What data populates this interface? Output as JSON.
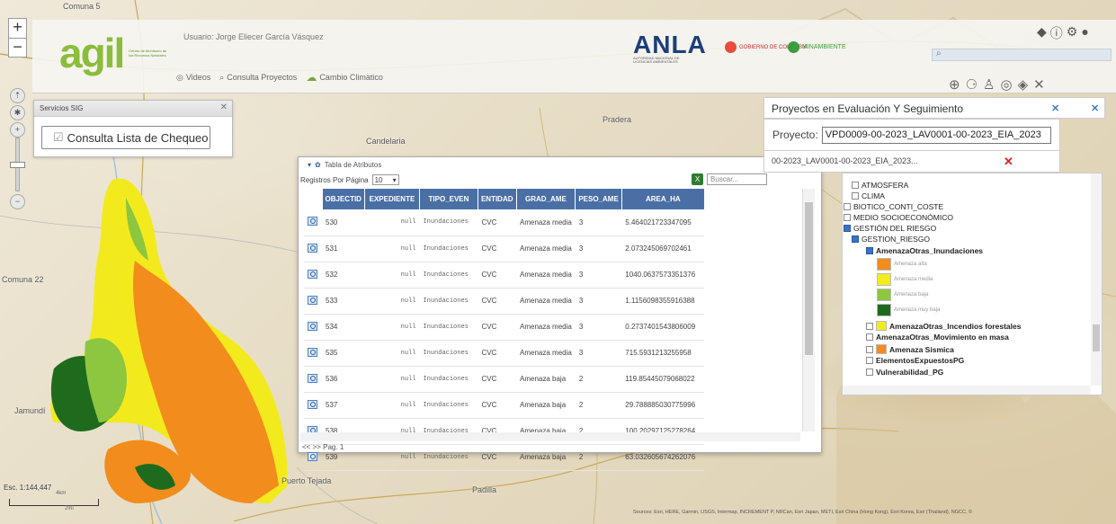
{
  "header": {
    "logo": "agil",
    "logo_sub": "Centro de Monitoreo de los Recursos Naturales",
    "user": "Usuario: Jorge Eliecer García Vásquez",
    "nav": [
      "Videos",
      "Consulta Proyectos",
      "Cambio Climatico"
    ],
    "brand": "ANLA",
    "brand_sub": "AUTORIDAD NACIONAL DE LICENCIAS AMBIENTALES",
    "gob": "GOBIERNO DE COLOMBIA",
    "min": "MINAMBIENTE",
    "search_placeholder": ""
  },
  "map_labels": {
    "comuna5": "Comuna 5",
    "candelaria": "Candelaria",
    "pradera": "Pradera",
    "comuna22": "Comuna 22",
    "jamundi": "Jamundí",
    "puerto_tejada": "Puerto Tejada",
    "padilla": "Padilla"
  },
  "sig_panel": {
    "title": "Servicios SIG",
    "button": "Consulta Lista de Chequeo"
  },
  "attr_table": {
    "title": "Tabla de Atributos",
    "per_page_label": "Registros Por Página",
    "per_page_value": "10",
    "search_placeholder": "Buscar...",
    "columns": [
      "OBJECTID",
      "EXPEDIENTE",
      "TIPO_EVEN",
      "ENTIDAD",
      "GRAD_AME",
      "PESO_AME",
      "AREA_ha"
    ],
    "rows": [
      {
        "id": "530",
        "exp": "null",
        "tipo": "Inundaciones",
        "ent": "CVC",
        "grad": "Amenaza media",
        "peso": "3",
        "area": "5.464021723347095"
      },
      {
        "id": "531",
        "exp": "null",
        "tipo": "Inundaciones",
        "ent": "CVC",
        "grad": "Amenaza media",
        "peso": "3",
        "area": "2.073245069702461"
      },
      {
        "id": "532",
        "exp": "null",
        "tipo": "Inundaciones",
        "ent": "CVC",
        "grad": "Amenaza media",
        "peso": "3",
        "area": "1040.0637573351376"
      },
      {
        "id": "533",
        "exp": "null",
        "tipo": "Inundaciones",
        "ent": "CVC",
        "grad": "Amenaza media",
        "peso": "3",
        "area": "1.1156098355916388"
      },
      {
        "id": "534",
        "exp": "null",
        "tipo": "Inundaciones",
        "ent": "CVC",
        "grad": "Amenaza media",
        "peso": "3",
        "area": "0.2737401543806009"
      },
      {
        "id": "535",
        "exp": "null",
        "tipo": "Inundaciones",
        "ent": "CVC",
        "grad": "Amenaza media",
        "peso": "3",
        "area": "715.5931213255958"
      },
      {
        "id": "536",
        "exp": "null",
        "tipo": "Inundaciones",
        "ent": "CVC",
        "grad": "Amenaza baja",
        "peso": "2",
        "area": "119.85445079068022"
      },
      {
        "id": "537",
        "exp": "null",
        "tipo": "Inundaciones",
        "ent": "CVC",
        "grad": "Amenaza baja",
        "peso": "2",
        "area": "29.788885030775996"
      },
      {
        "id": "538",
        "exp": "null",
        "tipo": "Inundaciones",
        "ent": "CVC",
        "grad": "Amenaza baja",
        "peso": "2",
        "area": "100.20297125278264"
      },
      {
        "id": "539",
        "exp": "null",
        "tipo": "Inundaciones",
        "ent": "CVC",
        "grad": "Amenaza baja",
        "peso": "2",
        "area": "63.032605674262076"
      }
    ],
    "pager": "<< >> Pag. 1"
  },
  "layers_panel": {
    "title": "Proyectos en Evaluación Y Seguimiento",
    "project_label": "Proyecto:",
    "project_value": "VPD0009-00-2023_LAV0001-00-2023_EIA_2023",
    "chip": "00-2023_LAV0001-00-2023_EIA_2023...",
    "tree": [
      "ATMOSFERA",
      "CLIMA",
      "BIOTICO_CONTI_COSTE",
      "MEDIO SOCIOECONÓMICO",
      "GESTIÓN DEL RIESGO",
      "GESTION_RIESGO",
      "AmenazaOtras_Inundaciones",
      "AmenazaOtras_Incendios forestales",
      "AmenazaOtras_Movimiento en masa",
      "Amenaza Sismica",
      "ElementosExpuestosPG",
      "Vulnerabilidad_PG"
    ],
    "legend": [
      {
        "label": "Amenaza alta",
        "color": "#f28c1c"
      },
      {
        "label": "Amenaza media",
        "color": "#f2ec1c"
      },
      {
        "label": "Amenaza baja",
        "color": "#8dc63f"
      },
      {
        "label": "Amenaza muy baja",
        "color": "#1e6b1e"
      }
    ]
  },
  "scale": "Esc. 1:144,447",
  "scale_units": [
    "4km",
    "2mi"
  ],
  "attribution": "Sources: Esri, HERE, Garmin, USGS, Intermap, INCREMENT P, NRCan, Esri Japan, METI, Esri China (Hong Kong), Esri Korea, Esri (Thailand), NGCC, ©"
}
